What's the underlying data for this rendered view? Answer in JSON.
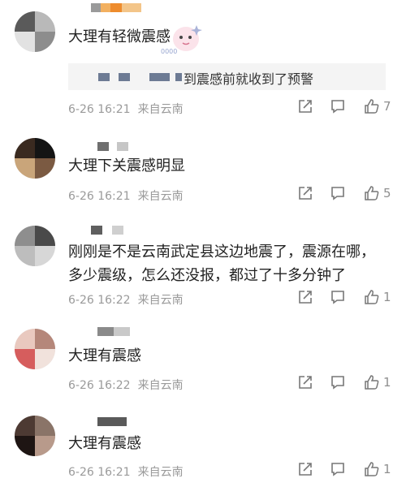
{
  "comments": [
    {
      "text": "大理有轻微震感",
      "time": "6-26 16:21",
      "source": "来自云南",
      "likes": "7",
      "reply": {
        "text": "到震感前就收到了预警"
      }
    },
    {
      "text": "大理下关震感明显",
      "time": "6-26 16:21",
      "source": "来自云南",
      "likes": "5"
    },
    {
      "text_line1": "刚刚是不是云南武定县这边地震了，震源在哪，",
      "text_line2": "多少震级，怎么还没报，都过了十多分钟了",
      "time": "6-26 16:22",
      "source": "来自云南",
      "likes": "1"
    },
    {
      "text": "大理有震感",
      "time": "6-26 16:22",
      "source": "来自云南",
      "likes": "1"
    },
    {
      "text": "大理有震感",
      "time": "6-26 16:21",
      "source": "来自云南",
      "likes": "1"
    }
  ],
  "icons": [
    "share-icon",
    "comment-icon",
    "like-icon"
  ],
  "colors": {
    "text": "#222222",
    "meta": "#9a9a9a",
    "reply_bg": "#f4f4f4"
  }
}
